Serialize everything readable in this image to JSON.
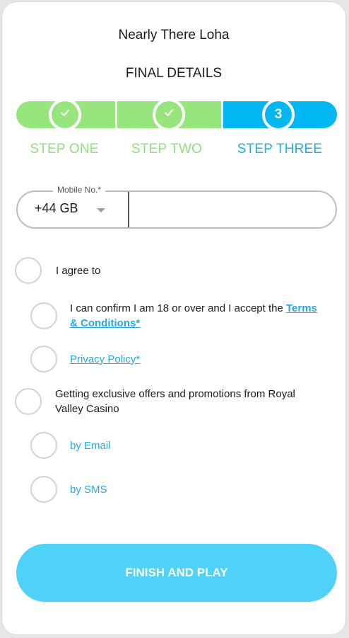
{
  "header": {
    "greeting": "Nearly There Loha",
    "subtitle": "FINAL DETAILS"
  },
  "colors": {
    "complete": "#96e67d",
    "complete_text": "#8ee27a",
    "active": "#00b7f1",
    "active_text": "#22aee7",
    "link": "#26a9e0",
    "button": "#4fd2f8"
  },
  "stepper": {
    "steps": [
      {
        "label": "STEP ONE",
        "status": "complete",
        "icon": "check-icon"
      },
      {
        "label": "STEP TWO",
        "status": "complete",
        "icon": "check-icon"
      },
      {
        "label": "STEP THREE",
        "status": "active",
        "number": "3"
      }
    ]
  },
  "phone": {
    "label": "Mobile No.*",
    "country_code": "+44 GB",
    "number_value": "",
    "number_placeholder": ""
  },
  "consent": {
    "agree_label": "I agree to",
    "terms_prefix": "I can confirm I am 18 or over and I accept the ",
    "terms_link_line1": "Terms",
    "terms_link_line2": "& Conditions*",
    "privacy_link": "Privacy Policy*",
    "offers_label": "Getting exclusive offers and promotions from Royal Valley Casino",
    "email_label": "by Email",
    "sms_label": "by SMS"
  },
  "finish_button": {
    "label": "FINISH AND PLAY"
  }
}
